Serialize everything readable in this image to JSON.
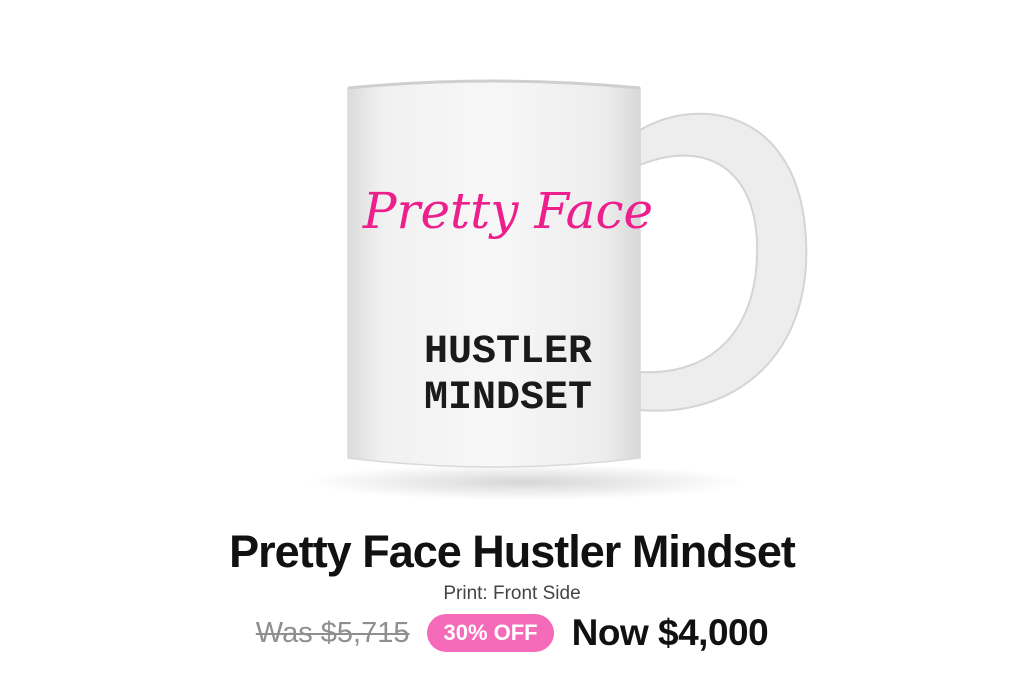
{
  "product": {
    "image": {
      "description": "white ceramic mug",
      "print_line1": "Pretty Face",
      "print_line2": "HUSTLER",
      "print_line3": "MINDSET",
      "script_color": "#ec1f8c"
    },
    "title": "Pretty Face Hustler Mindset",
    "print_option": "Print: Front Side",
    "price": {
      "was": "Was $5,715",
      "discount": "30% OFF",
      "now": "Now $4,000"
    }
  },
  "colors": {
    "badge": "#f56bb9",
    "text": "#111111",
    "muted": "#8f8f8f"
  }
}
